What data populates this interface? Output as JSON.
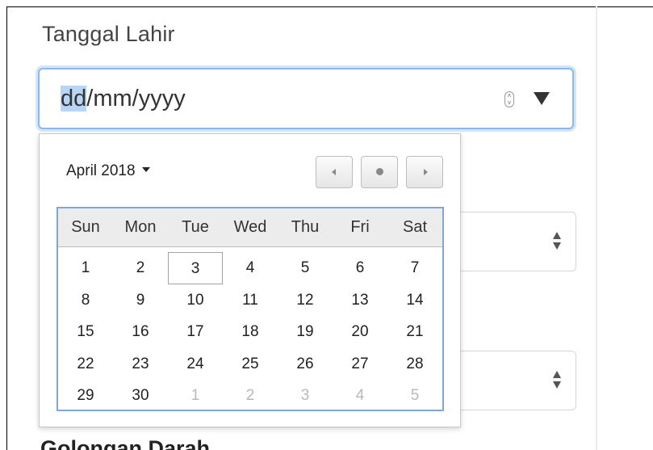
{
  "field_label": "Tanggal Lahir",
  "date_input": {
    "segment_day": "dd",
    "rest_format": "/mm/yyyy",
    "focus_color": "#8ab8ef",
    "selection_color": "#b7d5f6"
  },
  "icons": [
    "spin-stepper-icon",
    "dropdown-arrow-icon",
    "chevron-left-icon",
    "dot-icon",
    "chevron-right-icon",
    "updown-icon"
  ],
  "calendar": {
    "month_label": "April 2018",
    "weekdays": [
      "Sun",
      "Mon",
      "Tue",
      "Wed",
      "Thu",
      "Fri",
      "Sat"
    ],
    "today": "3",
    "weeks": [
      [
        "1",
        "2",
        "3",
        "4",
        "5",
        "6",
        "7"
      ],
      [
        "8",
        "9",
        "10",
        "11",
        "12",
        "13",
        "14"
      ],
      [
        "15",
        "16",
        "17",
        "18",
        "19",
        "20",
        "21"
      ],
      [
        "22",
        "23",
        "24",
        "25",
        "26",
        "27",
        "28"
      ],
      [
        "29",
        "30",
        "1",
        "2",
        "3",
        "4",
        "5"
      ]
    ],
    "other_month_marker_from": [
      "4",
      "2"
    ],
    "grid_border_color": "#7fa6d4"
  },
  "bottom_label": "Golongan Darah"
}
